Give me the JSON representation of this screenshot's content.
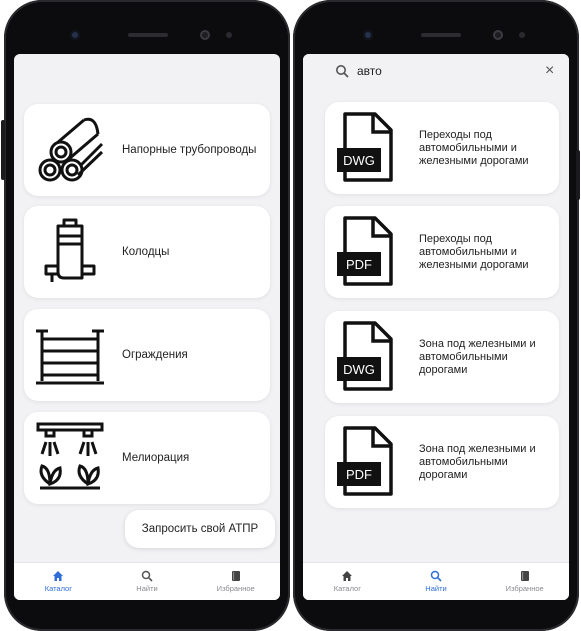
{
  "left_screen": {
    "categories": [
      {
        "label": "Напорные трубопроводы",
        "icon": "pipes-icon"
      },
      {
        "label": "Колодцы",
        "icon": "well-icon"
      },
      {
        "label": "Ограждения",
        "icon": "fence-icon"
      },
      {
        "label": "Мелиорация",
        "icon": "irrigation-icon"
      }
    ],
    "request_button": "Запросить свой АТПР",
    "tabbar": [
      {
        "label": "Каталог",
        "icon": "home-icon",
        "active": true
      },
      {
        "label": "Найти",
        "icon": "search-icon",
        "active": false
      },
      {
        "label": "Избранное",
        "icon": "bookmark-icon",
        "active": false
      }
    ]
  },
  "right_screen": {
    "search": {
      "value": "авто",
      "clear": "×"
    },
    "results": [
      {
        "format": "DWG",
        "label": "Переходы под автомобильными и железными дорогами"
      },
      {
        "format": "PDF",
        "label": "Переходы под автомобильными и железными дорогами"
      },
      {
        "format": "DWG",
        "label": "Зона под железными и автомобильными дорогами"
      },
      {
        "format": "PDF",
        "label": "Зона под железными и автомобильными дорогами"
      }
    ],
    "tabbar": [
      {
        "label": "Каталог",
        "icon": "home-icon",
        "active": false
      },
      {
        "label": "Найти",
        "icon": "search-icon",
        "active": true
      },
      {
        "label": "Избранное",
        "icon": "bookmark-icon",
        "active": false
      }
    ]
  },
  "colors": {
    "accent": "#2f6ed8",
    "inactive": "#8a8a90",
    "background": "#f2f2f4",
    "card": "#ffffff"
  }
}
